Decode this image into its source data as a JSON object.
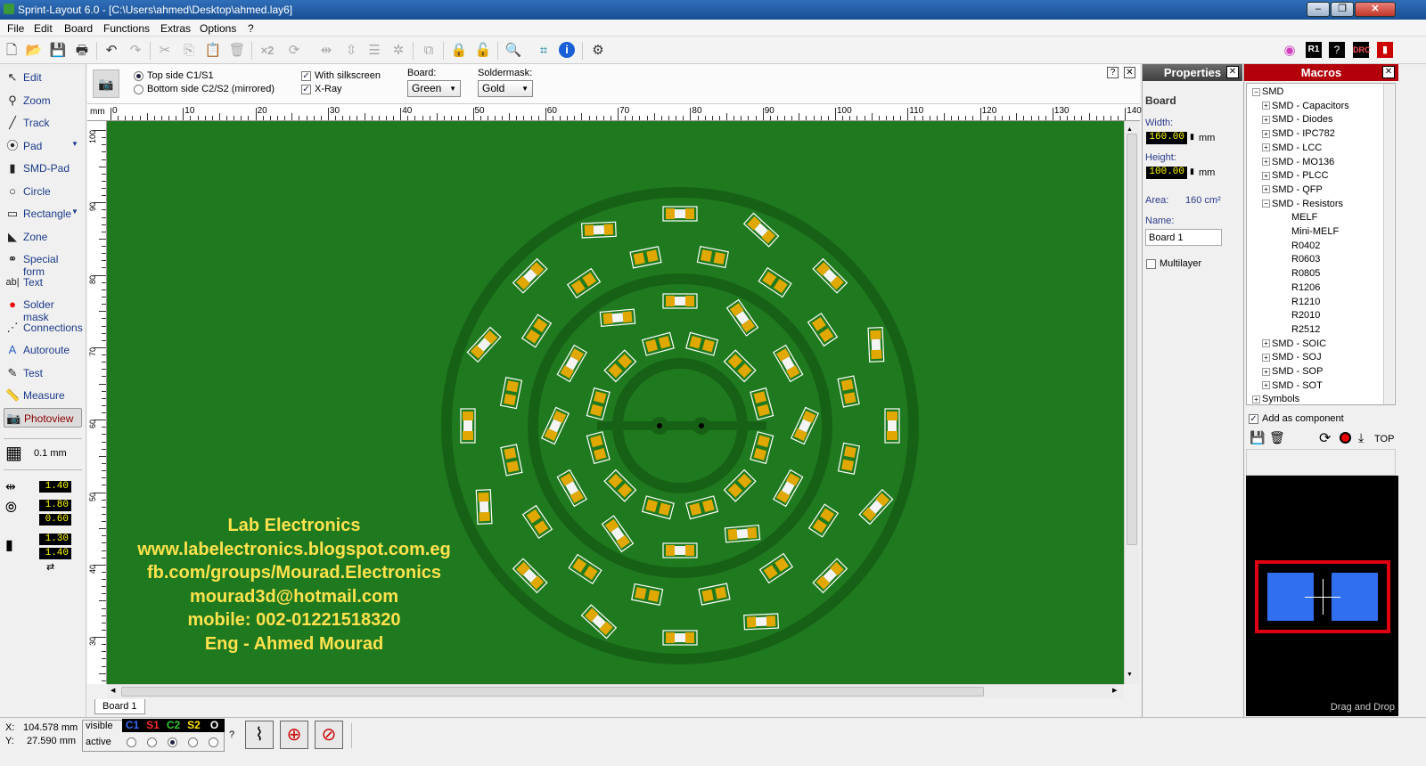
{
  "window": {
    "title": "Sprint-Layout 6.0 - [C:\\Users\\ahmed\\Desktop\\ahmed.lay6]"
  },
  "menu": [
    "File",
    "Edit",
    "Board",
    "Functions",
    "Extras",
    "Options",
    "?"
  ],
  "toolbar": {
    "x2_label": "×2"
  },
  "tools": [
    {
      "label": "Edit",
      "icon": "cursor-icon"
    },
    {
      "label": "Zoom",
      "icon": "magnifier-icon"
    },
    {
      "label": "Track",
      "icon": "track-icon"
    },
    {
      "label": "Pad",
      "icon": "pad-icon"
    },
    {
      "label": "SMD-Pad",
      "icon": "smd-pad-icon"
    },
    {
      "label": "Circle",
      "icon": "circle-icon"
    },
    {
      "label": "Rectangle",
      "icon": "rectangle-icon"
    },
    {
      "label": "Zone",
      "icon": "zone-icon"
    },
    {
      "label": "Special form",
      "icon": "special-form-icon"
    },
    {
      "label": "Text",
      "icon": "text-icon"
    },
    {
      "label": "Solder mask",
      "icon": "solder-mask-icon"
    },
    {
      "label": "Connections",
      "icon": "connections-icon"
    },
    {
      "label": "Autoroute",
      "icon": "autoroute-icon"
    },
    {
      "label": "Test",
      "icon": "test-icon"
    },
    {
      "label": "Measure",
      "icon": "measure-icon"
    },
    {
      "label": "Photoview",
      "icon": "photoview-icon"
    }
  ],
  "grid": {
    "label": "0.1 mm"
  },
  "values": {
    "track_width": "1.40",
    "pad_outer": "1.80",
    "pad_inner": "0.60",
    "smd_w": "1.30",
    "smd_h": "1.40"
  },
  "photoview": {
    "side_top": "Top side C1/S1",
    "side_bottom": "Bottom side C2/S2 (mirrored)",
    "silkscreen": "With silkscreen",
    "xray": "X-Ray",
    "board_label": "Board:",
    "board_value": "Green",
    "soldermask_label": "Soldermask:",
    "soldermask_value": "Gold"
  },
  "ruler": {
    "unit": "mm",
    "top_ticks": [
      "0",
      "10",
      "20",
      "30",
      "40",
      "50",
      "60",
      "70",
      "80",
      "90",
      "100",
      "110",
      "120",
      "130",
      "140"
    ],
    "left_ticks": [
      "100",
      "90",
      "80",
      "70",
      "60",
      "50",
      "40",
      "30"
    ]
  },
  "board_text": [
    "Lab Electronics",
    "www.labelectronics.blogspot.com.eg",
    "fb.com/groups/Mourad.Electronics",
    "mourad3d@hotmail.com",
    "mobile: 002-01221518320",
    "Eng - Ahmed Mourad"
  ],
  "tab": "Board 1",
  "properties": {
    "title": "Properties",
    "section": "Board",
    "width_label": "Width:",
    "width_value": "160.00",
    "height_label": "Height:",
    "height_value": "100.00",
    "unit": "mm",
    "area_label": "Area:",
    "area_value": "160 cm²",
    "name_label": "Name:",
    "name_value": "Board 1",
    "multilayer": "Multilayer"
  },
  "macros": {
    "title": "Macros",
    "tree": [
      {
        "label": "SMD",
        "level": 0,
        "box": "−"
      },
      {
        "label": "SMD - Capacitors",
        "level": 1,
        "box": "+"
      },
      {
        "label": "SMD - Diodes",
        "level": 1,
        "box": "+"
      },
      {
        "label": "SMD - IPC782",
        "level": 1,
        "box": "+"
      },
      {
        "label": "SMD - LCC",
        "level": 1,
        "box": "+"
      },
      {
        "label": "SMD - MO136",
        "level": 1,
        "box": "+"
      },
      {
        "label": "SMD - PLCC",
        "level": 1,
        "box": "+"
      },
      {
        "label": "SMD - QFP",
        "level": 1,
        "box": "+"
      },
      {
        "label": "SMD - Resistors",
        "level": 1,
        "box": "−"
      },
      {
        "label": "MELF",
        "level": 2,
        "box": ""
      },
      {
        "label": "Mini-MELF",
        "level": 2,
        "box": ""
      },
      {
        "label": "R0402",
        "level": 2,
        "box": ""
      },
      {
        "label": "R0603",
        "level": 2,
        "box": ""
      },
      {
        "label": "R0805",
        "level": 2,
        "box": ""
      },
      {
        "label": "R1206",
        "level": 2,
        "box": ""
      },
      {
        "label": "R1210",
        "level": 2,
        "box": ""
      },
      {
        "label": "R2010",
        "level": 2,
        "box": ""
      },
      {
        "label": "R2512",
        "level": 2,
        "box": ""
      },
      {
        "label": "SMD - SOIC",
        "level": 1,
        "box": "+"
      },
      {
        "label": "SMD - SOJ",
        "level": 1,
        "box": "+"
      },
      {
        "label": "SMD - SOP",
        "level": 1,
        "box": "+"
      },
      {
        "label": "SMD - SOT",
        "level": 1,
        "box": "+"
      },
      {
        "label": "Symbols",
        "level": 0,
        "box": "+"
      }
    ],
    "add_as_component": "Add as component",
    "top_label": "TOP",
    "drag_drop": "Drag and Drop"
  },
  "status": {
    "x_label": "X:",
    "x_value": "104.578 mm",
    "y_label": "Y:",
    "y_value": "27.590 mm",
    "visible": "visible",
    "active": "active",
    "help": "?",
    "layers": [
      {
        "name": "C1",
        "color": "#3b6cff"
      },
      {
        "name": "S1",
        "color": "#ff2a2a"
      },
      {
        "name": "C2",
        "color": "#33cc33"
      },
      {
        "name": "S2",
        "color": "#ffe000"
      },
      {
        "name": "O",
        "color": "#ffffff"
      }
    ]
  }
}
